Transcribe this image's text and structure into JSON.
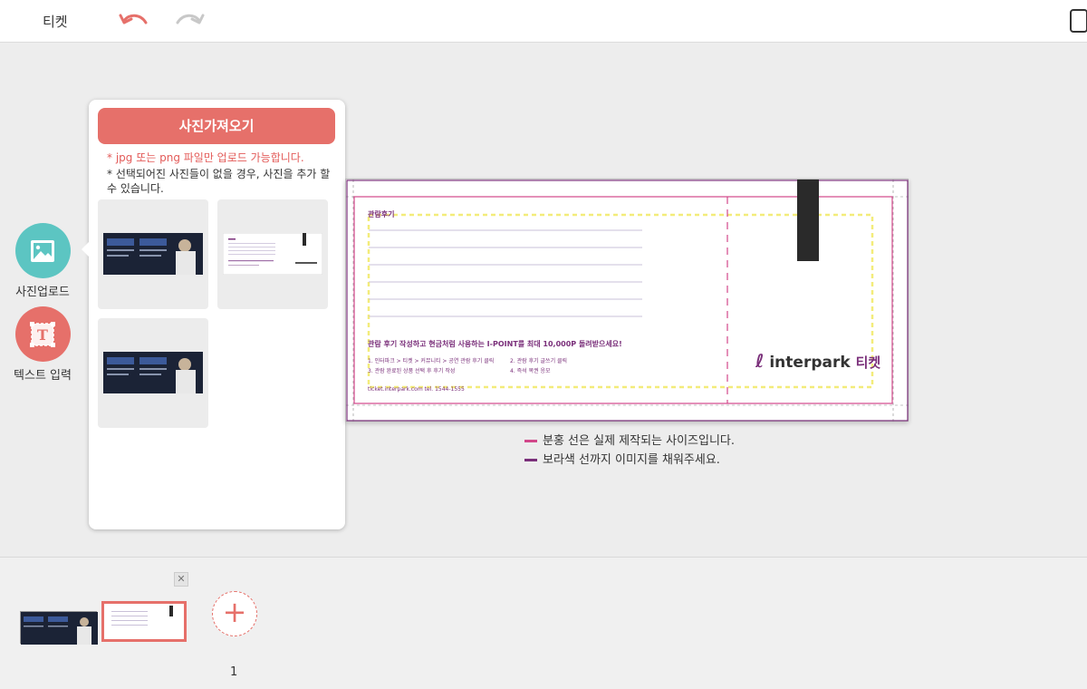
{
  "topbar": {
    "title": "티켓"
  },
  "tools": {
    "photo_upload_label": "사진업로드",
    "text_input_label": "텍스트 입력"
  },
  "popup": {
    "import_button": "사진가져오기",
    "note_format": "* jpg 또는 png 파일만 업로드 가능합니다.",
    "note_add": "* 선택되어진 사진들이 없을 경우, 사진을 추가 할 수 있습니다."
  },
  "ticket": {
    "heading": "관람후기",
    "promo": "관람 후기 작성하고 현금처럼 사용하는 I-POINT를 최대 10,000P 돌려받으세요!",
    "steps": [
      "1. 인터파크 > 티켓 > 커뮤니티 > 공연 관람 후기 클릭",
      "2. 관람 후기 글쓰기 클릭",
      "3. 관람 완료된 상품 선택 후 후기 작성",
      "4. 즉석 복권 응모"
    ],
    "footer": "ticket.interpark.com    tel. 1544-1555",
    "logo_brand": "interpark",
    "logo_suffix": "티켓"
  },
  "legend": {
    "pink": "분홍 선은 실제 제작되는 사이즈입니다.",
    "purple": "보라색 선까지 이미지를 채워주세요."
  },
  "pages": {
    "current_page": "1",
    "close_symbol": "✕",
    "add_symbol": "+"
  },
  "colors": {
    "accent_coral": "#e6706a",
    "accent_teal": "#5cc5c2",
    "print_size_pink": "#d2478a",
    "bleed_purple": "#7a2f7a",
    "safe_yellow": "#f3ec7a"
  }
}
